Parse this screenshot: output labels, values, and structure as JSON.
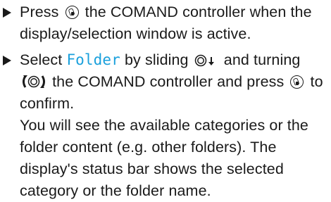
{
  "instructions": {
    "step1": {
      "part1": "Press",
      "part2": "the COMAND controller when the display/selection window is active."
    },
    "step2": {
      "part1": "Select",
      "softkey": "Folder",
      "part2": "by sliding",
      "part3": "and turning",
      "part4": "the COMAND controller and press",
      "part5": "to confirm.",
      "result": "You will see the available categories or the folder content (e.g. other folders). The display's status bar shows the selected category or the folder name."
    }
  },
  "icons": {
    "press": "press-controller-icon",
    "slide": "slide-down-controller-icon",
    "turn": "turn-controller-icon"
  },
  "colors": {
    "text": "#1a1a1a",
    "softkey": "#1aa0dc",
    "background": "#ffffff"
  }
}
